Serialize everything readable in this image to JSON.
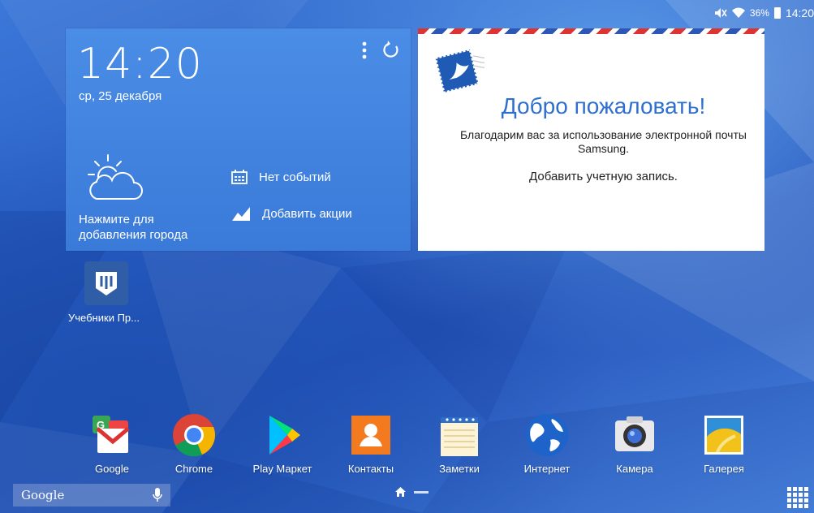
{
  "status_bar": {
    "battery": "36%",
    "time": "14:20"
  },
  "clock_widget": {
    "time": "14:20",
    "date": "ср, 25 декабря",
    "weather_hint": "Нажмите для добавления города",
    "events": "Нет событий",
    "stocks": "Добавить акции"
  },
  "email_widget": {
    "title": "Добро пожаловать!",
    "description": "Благодарим вас за использование электронной почты Samsung.",
    "add_account": "Добавить учетную запись."
  },
  "shortcut": {
    "label": "Учебники Пр..."
  },
  "dock": {
    "apps": [
      {
        "label": "Google",
        "icon": "gmail-folder-icon"
      },
      {
        "label": "Chrome",
        "icon": "chrome-icon"
      },
      {
        "label": "Play Маркет",
        "icon": "play-store-icon"
      },
      {
        "label": "Контакты",
        "icon": "contacts-icon"
      },
      {
        "label": "Заметки",
        "icon": "memo-icon"
      },
      {
        "label": "Интернет",
        "icon": "globe-icon"
      },
      {
        "label": "Камера",
        "icon": "camera-icon"
      },
      {
        "label": "Галерея",
        "icon": "gallery-icon"
      }
    ]
  },
  "search_bar": {
    "logo": "Google"
  },
  "colors": {
    "accent_blue": "#2f6fd0",
    "widget_blue": "#4a8de6"
  }
}
